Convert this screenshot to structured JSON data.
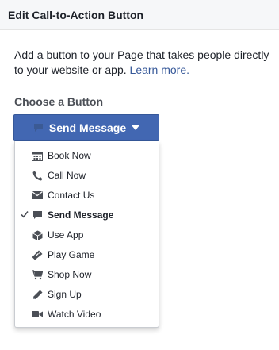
{
  "header": {
    "title": "Edit Call-to-Action Button"
  },
  "description": {
    "text": "Add a button to your Page that takes people directly to your website or app.",
    "link_text": "Learn more."
  },
  "section": {
    "title": "Choose a Button"
  },
  "cta_button": {
    "label": "Send Message",
    "icon": "speech-bubble-icon",
    "caret_icon": "caret-down-icon"
  },
  "colors": {
    "primary": "#4267b2",
    "link": "#365899",
    "icon_gray": "#4b4f56"
  },
  "menu": {
    "selected_index": 3,
    "items": [
      {
        "label": "Book Now",
        "icon": "calendar-icon"
      },
      {
        "label": "Call Now",
        "icon": "phone-icon"
      },
      {
        "label": "Contact Us",
        "icon": "envelope-icon"
      },
      {
        "label": "Send Message",
        "icon": "speech-bubble-icon"
      },
      {
        "label": "Use App",
        "icon": "cube-icon"
      },
      {
        "label": "Play Game",
        "icon": "gamepad-icon"
      },
      {
        "label": "Shop Now",
        "icon": "cart-icon"
      },
      {
        "label": "Sign Up",
        "icon": "pencil-icon"
      },
      {
        "label": "Watch Video",
        "icon": "video-camera-icon"
      }
    ]
  }
}
